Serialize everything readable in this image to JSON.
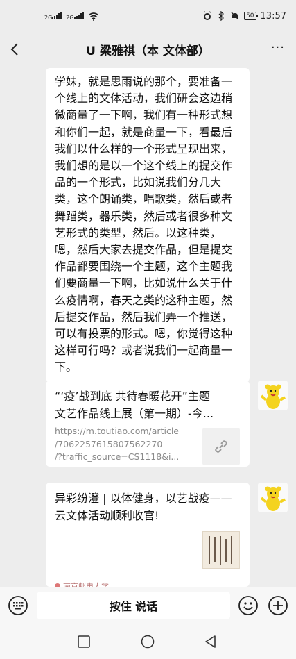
{
  "status": {
    "sim1": "2G",
    "sim2": "2G",
    "battery": "50",
    "time": "13:57"
  },
  "header": {
    "title": "U 梁雅祺（本 文体部）",
    "more": "···"
  },
  "messages": {
    "text1": "学妹，就是思雨说的那个，要准备一个线上的文体活动，我们研会这边稍微商量了一下啊，我们有一种形式想和你们一起，就是商量一下，看最后我们以什么样的一个形式呈现出来，我们想的是以一个这个线上的提交作品的一个形式，比如说我们分几大类，这个朗诵类，唱歌类，然后或者舞蹈类，器乐类，然后或者很多种文艺形式的类型，然后。以这种类，嗯，然后大家去提交作品，但是提交作品都要围绕一个主题，这个主题我们要商量一下啊，比如说什么关于什么疫情啊，春天之类的这种主题，然后提交作品，然后我们弄一个推送，可以有投票的形式。嗯，你觉得这种这样可行吗？或者说我们一起商量一下。",
    "card1": {
      "title_line1": "“‘疫’战到底 共待春暖花开”主题",
      "title_line2": "文艺作品线上展（第一期）-今...",
      "url": "https://m.toutiao.com/article\n/7062257615807562270\n/?traffic_source=CS1118&i..."
    },
    "card2": {
      "title": "异彩纷澄 | 以体健身，以艺战疫——云文体活动顺利收官!",
      "footer": "南京邮电大学"
    }
  },
  "input": {
    "voice_label": "按住 说话"
  },
  "colors": {
    "background": "#ededed",
    "bubble": "#ffffff",
    "url_gray": "#8a8a8a",
    "avatar_yellow": "#f4d31f"
  },
  "icons": [
    "back-arrow-icon",
    "more-icon",
    "link-icon",
    "keyboard-icon",
    "emoji-icon",
    "plus-icon",
    "nav-square-icon",
    "nav-home-icon",
    "nav-back-icon"
  ]
}
